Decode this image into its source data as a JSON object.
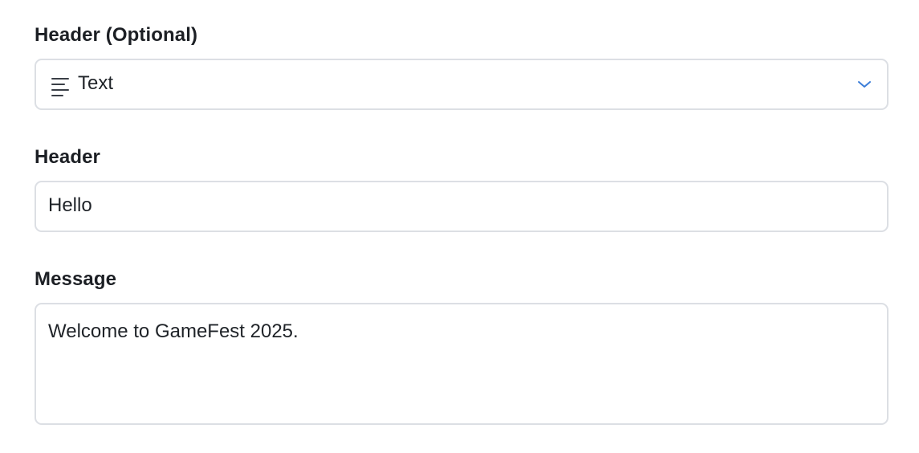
{
  "header_type": {
    "label": "Header (Optional)",
    "selected": "Text",
    "icon": "text-lines-icon",
    "dropdown_icon": "chevron-down-icon",
    "accent_color": "#3b7dd8"
  },
  "header": {
    "label": "Header",
    "value": "Hello"
  },
  "message": {
    "label": "Message",
    "value": "Welcome to GameFest 2025."
  }
}
